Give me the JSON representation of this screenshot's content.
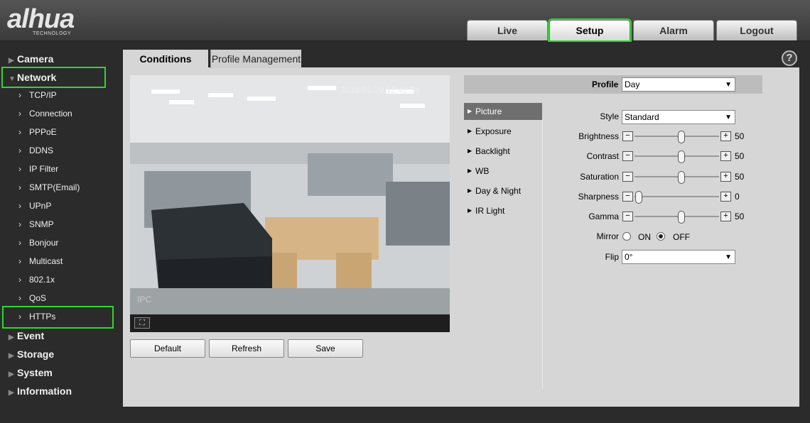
{
  "brand": {
    "logo": "alhua",
    "sub": "TECHNOLOGY"
  },
  "topnav": [
    {
      "label": "Live"
    },
    {
      "label": "Setup"
    },
    {
      "label": "Alarm"
    },
    {
      "label": "Logout"
    }
  ],
  "sidebar": {
    "camera": "Camera",
    "network": "Network",
    "network_items": [
      "TCP/IP",
      "Connection",
      "PPPoE",
      "DDNS",
      "IP Filter",
      "SMTP(Email)",
      "UPnP",
      "SNMP",
      "Bonjour",
      "Multicast",
      "802.1x",
      "QoS",
      "HTTPs"
    ],
    "event": "Event",
    "storage": "Storage",
    "system": "System",
    "information": "Information"
  },
  "tabs": {
    "conditions": "Conditions",
    "profile_management": "Profile Management"
  },
  "help": "?",
  "video": {
    "timestamp": "2018-01-29 12:42:34",
    "channel": "IPC"
  },
  "buttons": {
    "default": "Default",
    "refresh": "Refresh",
    "save": "Save"
  },
  "profile": {
    "label": "Profile",
    "value": "Day"
  },
  "menu": [
    "Picture",
    "Exposure",
    "Backlight",
    "WB",
    "Day & Night",
    "IR Light"
  ],
  "picture": {
    "style_label": "Style",
    "style_value": "Standard",
    "brightness_label": "Brightness",
    "brightness": 50,
    "contrast_label": "Contrast",
    "contrast": 50,
    "saturation_label": "Saturation",
    "saturation": 50,
    "sharpness_label": "Sharpness",
    "sharpness": 0,
    "gamma_label": "Gamma",
    "gamma": 50,
    "mirror_label": "Mirror",
    "mirror_on": "ON",
    "mirror_off": "OFF",
    "mirror_value": "OFF",
    "flip_label": "Flip",
    "flip_value": "0°"
  },
  "colors": {
    "highlight": "#2fd62f",
    "menu_active": "#6f6f6f",
    "content_bg": "#d6d6d6"
  }
}
